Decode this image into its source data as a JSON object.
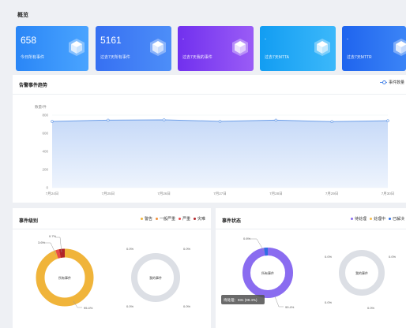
{
  "page": {
    "title": "概览"
  },
  "colors": {
    "card1": "#2e8ffb",
    "card2": "#3b7af5",
    "card3": "#7d3ef0",
    "card4": "#1aa3f3",
    "card5": "#2470f0",
    "line": "#6e9fe8",
    "area": "#c7daf8",
    "warning": "#f0b43a",
    "minor": "#f2903a",
    "severe": "#e84a4a",
    "critical": "#b0242a",
    "pending": "#8a6cf0",
    "processing": "#f6bd4a",
    "closed": "#2f6fe3",
    "empty": "#dcdfe5"
  },
  "stat_cards": [
    {
      "value": "658",
      "label": "今日所有事件",
      "icon": "cube-icon"
    },
    {
      "value": "5161",
      "label": "过去7天所有事件",
      "icon": "cube-icon"
    },
    {
      "value": "-",
      "label": "过去7天我的事件",
      "icon": "cube-icon"
    },
    {
      "value": "-",
      "label": "过去7天MTTA",
      "icon": "cube-icon"
    },
    {
      "value": "-",
      "label": "过去7天MTTR",
      "icon": "cube-icon"
    }
  ],
  "trend": {
    "title": "告警事件趋势",
    "legend_label": "事件数量"
  },
  "chart_data": {
    "type": "area",
    "ylabel": "数量/件",
    "ylim": [
      0,
      800
    ],
    "yticks": [
      "800",
      "600",
      "400",
      "200",
      "0"
    ],
    "categories": [
      "7月24日",
      "7月25日",
      "7月26日",
      "7月27日",
      "7月28日",
      "7月29日",
      "7月30日"
    ],
    "series": [
      {
        "name": "事件数量",
        "values": [
          730,
          745,
          748,
          732,
          745,
          728,
          738
        ]
      }
    ],
    "legend": "top-right",
    "grid": true
  },
  "level_panel": {
    "title": "事件级别",
    "legend": [
      {
        "label": "警告",
        "color_key": "warning"
      },
      {
        "label": "一般严重",
        "color_key": "minor"
      },
      {
        "label": "严重",
        "color_key": "severe"
      },
      {
        "label": "灾难",
        "color_key": "critical"
      }
    ],
    "donut1": {
      "center": "所有事件",
      "labels": [
        "0.7%",
        "3.6%",
        "95.4%"
      ],
      "fractions": [
        0.954,
        0.007,
        0.036,
        0.003
      ]
    },
    "donut2": {
      "center": "我的事件",
      "labels": [
        "0.0%",
        "0.0%",
        "0.0%",
        "0.0%"
      ]
    }
  },
  "status_panel": {
    "title": "事件状态",
    "legend": [
      {
        "label": "待处理",
        "color_key": "pending"
      },
      {
        "label": "处理中",
        "color_key": "processing"
      },
      {
        "label": "已解决",
        "color_key": "closed"
      }
    ],
    "donut1": {
      "center": "所有事件",
      "labels": [
        "0.6%",
        "99.4%"
      ],
      "fractions": [
        0.994,
        0.006
      ]
    },
    "tooltip": "待处理：931 (99.4%)",
    "donut2": {
      "center": "我的事件",
      "labels": [
        "0.0%",
        "0.0%",
        "0.0%",
        "0.0%"
      ]
    }
  }
}
